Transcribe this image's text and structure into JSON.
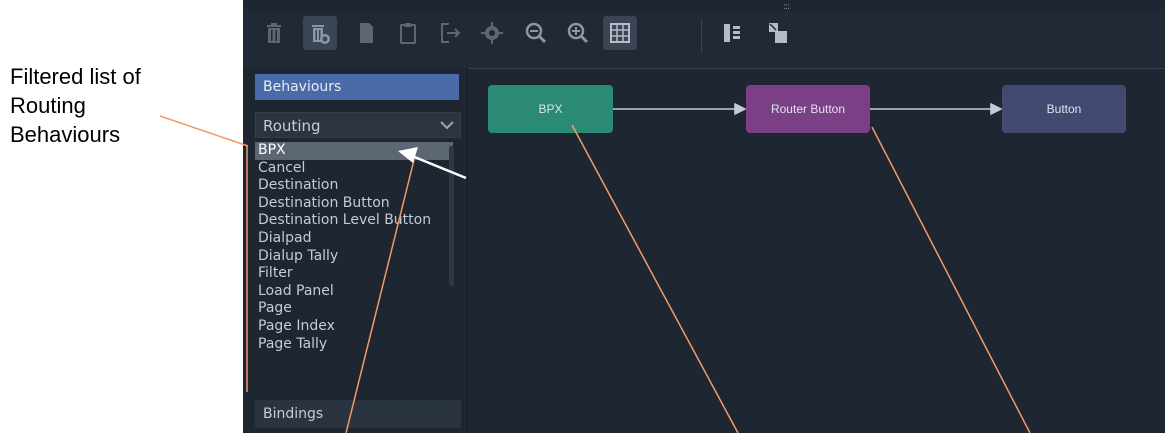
{
  "annotation": {
    "lines": [
      "Filtered list of",
      "Routing",
      "Behaviours"
    ]
  },
  "toolbar": {
    "grip": ":::",
    "buttons": [
      {
        "name": "delete-icon"
      },
      {
        "name": "delete-all-icon"
      },
      {
        "name": "copy-icon"
      },
      {
        "name": "paste-icon"
      },
      {
        "name": "export-icon"
      },
      {
        "name": "settings-icon"
      },
      {
        "name": "zoom-out-icon"
      },
      {
        "name": "zoom-in-icon"
      },
      {
        "name": "grid-icon"
      },
      {
        "name": "align-icon"
      },
      {
        "name": "layout-icon"
      }
    ]
  },
  "sidebar": {
    "behaviours_header": "Behaviours",
    "filter": {
      "selected": "Routing"
    },
    "items": [
      "BPX",
      "Cancel",
      "Destination",
      "Destination Button",
      "Destination Level Button",
      "Dialpad",
      "Dialup Tally",
      "Filter",
      "Load Panel",
      "Page",
      "Page Index",
      "Page Tally"
    ],
    "selected_index": 0,
    "bindings_header": "Bindings"
  },
  "canvas": {
    "nodes": {
      "bpx": {
        "label": "BPX",
        "color": "#2b8a73"
      },
      "router_button": {
        "label": "Router Button",
        "color": "#7a3f84"
      },
      "button": {
        "label": "Button",
        "color": "#434a72"
      }
    }
  },
  "colors": {
    "app_bg": "#1e2631",
    "accent": "#4a6aa8",
    "annotation_line": "#f39a6b"
  }
}
